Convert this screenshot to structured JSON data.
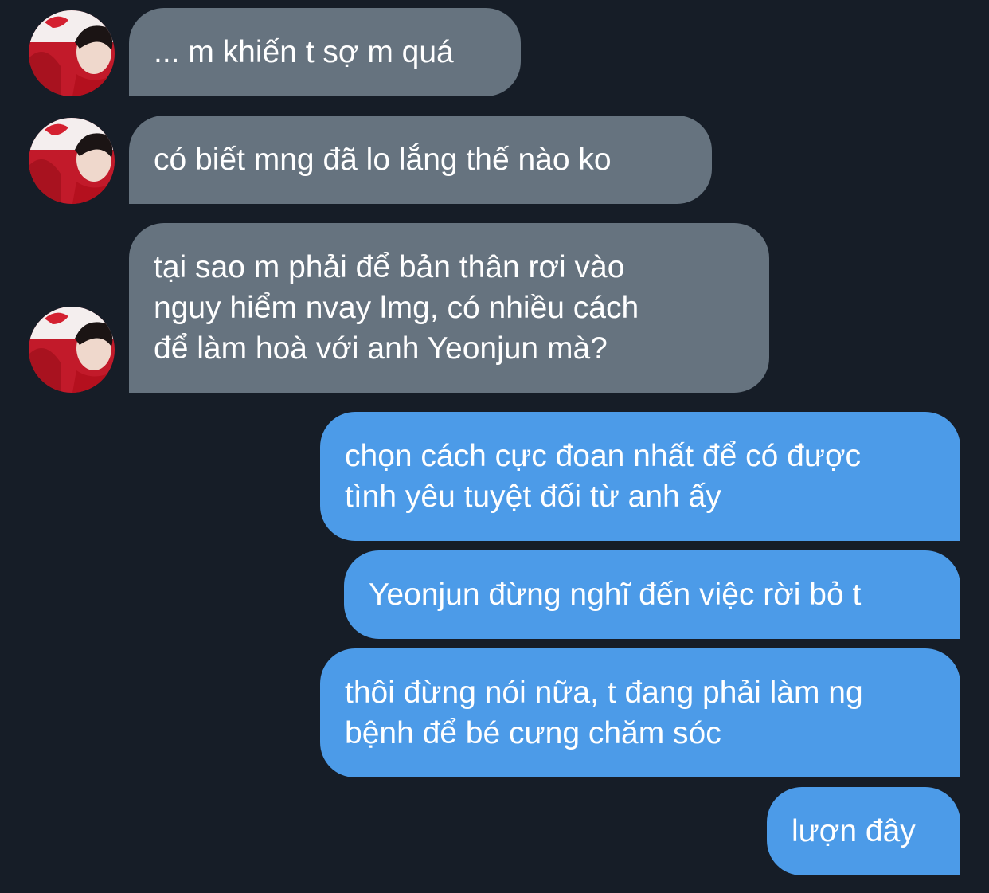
{
  "conversation": {
    "messages": [
      {
        "from": "other",
        "lines": [
          "... m khiến t sợ m quá"
        ]
      },
      {
        "from": "other",
        "lines": [
          "có biết mng đã lo lắng thế nào ko"
        ]
      },
      {
        "from": "other",
        "lines": [
          "tại sao m phải để bản thân rơi vào",
          "nguy hiểm nvay lmg, có nhiều cách",
          "để làm hoà với anh Yeonjun mà?"
        ]
      },
      {
        "from": "me",
        "lines": [
          "chọn cách cực đoan nhất để có được",
          "tình yêu tuyệt đối từ anh ấy"
        ]
      },
      {
        "from": "me",
        "lines": [
          "Yeonjun đừng nghĩ đến việc rời bỏ t"
        ]
      },
      {
        "from": "me",
        "lines": [
          "thôi đừng nói nữa, t đang phải làm ng",
          "bệnh để bé cưng chăm sóc"
        ]
      },
      {
        "from": "me",
        "lines": [
          "lượn đây"
        ]
      }
    ]
  },
  "colors": {
    "background": "#161d27",
    "incoming_bubble": "#66737f",
    "outgoing_bubble": "#4c9be8",
    "text": "#ffffff"
  },
  "icons": {
    "avatar": "avatar-photo-icon"
  }
}
